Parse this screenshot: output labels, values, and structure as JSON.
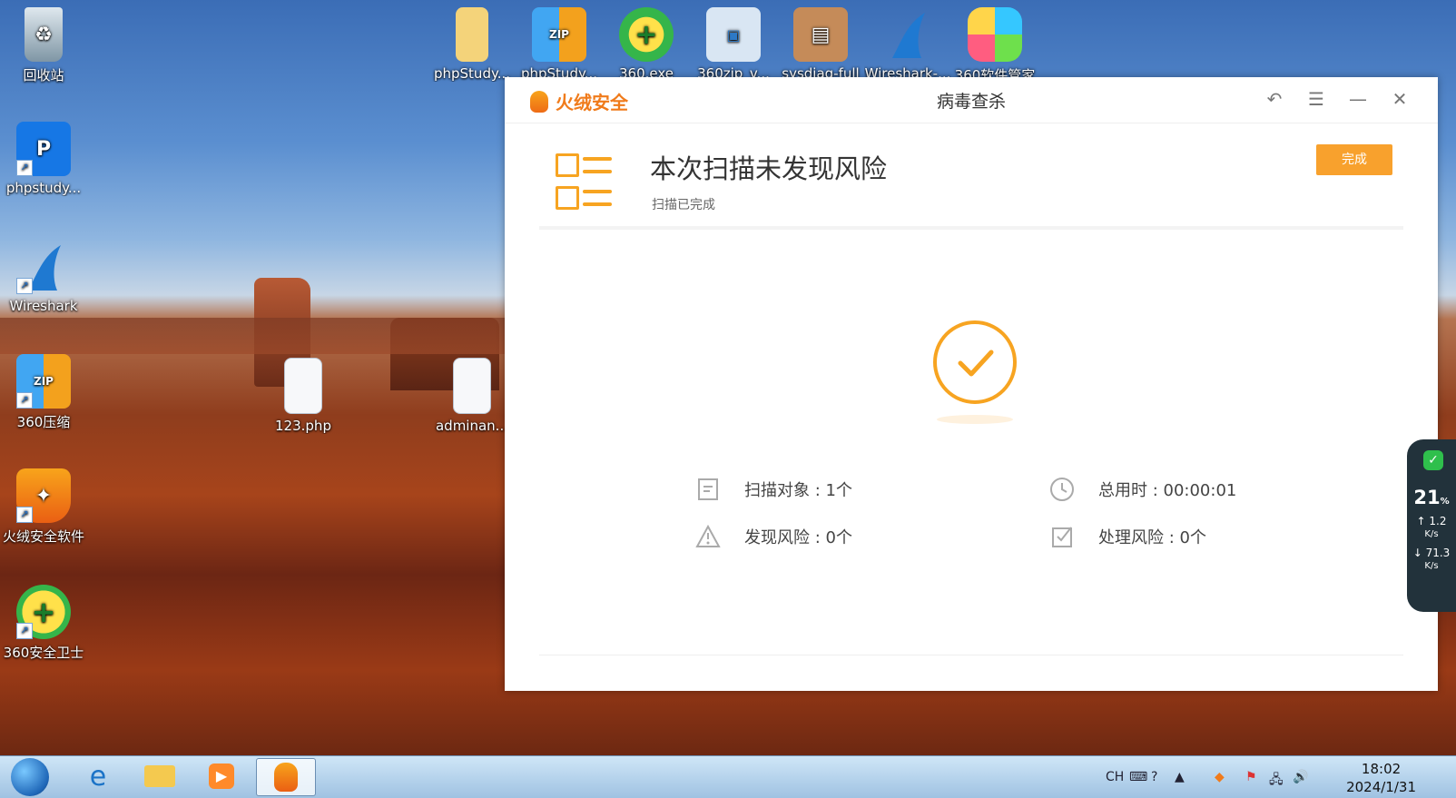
{
  "desktop": {
    "left_icons": [
      {
        "label": "回收站"
      },
      {
        "label": "phpstudy..."
      },
      {
        "label": "Wireshark"
      },
      {
        "label": "360压缩"
      },
      {
        "label": "火绒安全软件"
      },
      {
        "label": "360安全卫士"
      }
    ],
    "top_icons": [
      {
        "label": "phpStudy..."
      },
      {
        "label": "phpStudy..."
      },
      {
        "label": "360.exe"
      },
      {
        "label": "360zip_v..."
      },
      {
        "label": "sysdiag-full"
      },
      {
        "label": "Wireshark-..."
      },
      {
        "label": "360软件管家"
      }
    ],
    "middle_icons": [
      {
        "label": "123.php"
      },
      {
        "label": "adminan..."
      }
    ]
  },
  "window": {
    "brand": "火绒安全",
    "title": "病毒查杀",
    "result_title": "本次扫描未发现风险",
    "result_subtitle": "扫描已完成",
    "done_button": "完成",
    "stats": {
      "scan_objects": "扫描对象 : 1个",
      "total_time": "总用时 : 00:00:01",
      "risks_found": "发现风险 : 0个",
      "risks_handled": "处理风险 : 0个"
    }
  },
  "side_widget": {
    "percent": "21",
    "percent_unit": "%",
    "up_speed": "1.2",
    "down_speed": "71.3",
    "unit": "K/s"
  },
  "taskbar": {
    "input_lang": "CH",
    "time": "18:02",
    "date": "2024/1/31"
  },
  "colors": {
    "accent": "#f7a421",
    "button": "#f8a12d"
  }
}
